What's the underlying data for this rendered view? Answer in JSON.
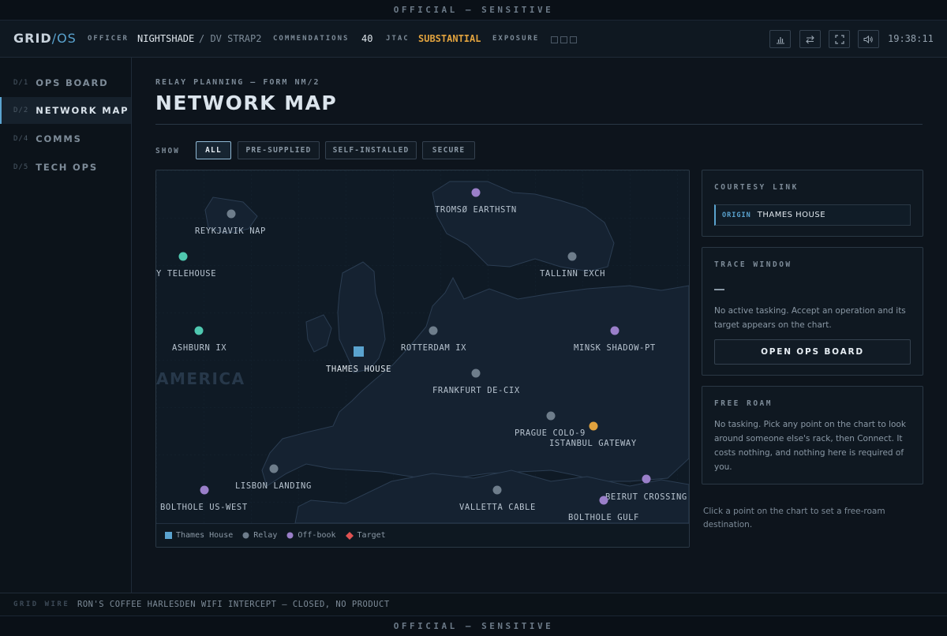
{
  "classification": "OFFICIAL — SENSITIVE",
  "topbar": {
    "brand": {
      "name": "GRID",
      "slash": "/",
      "os": "OS"
    },
    "officer_label": "OFFICER",
    "officer_name": "NIGHTSHADE",
    "officer_sub": "/ DV STRAP2",
    "commendations_label": "COMMENDATIONS",
    "commendations_value": "40",
    "jtac_label": "JTAC",
    "jtac_value": "SUBSTANTIAL",
    "exposure_label": "EXPOSURE",
    "exposure_level": 0,
    "exposure_max": 3,
    "buttons": [
      "bar-chart-icon",
      "swap-icon",
      "fullscreen-icon",
      "volume-icon"
    ],
    "clock": "19:38:11",
    "accent_color": "#5aa3cf",
    "amber_color": "#e0a23e"
  },
  "sidebar": {
    "items": [
      {
        "num": "D/1",
        "label": "OPS BOARD",
        "active": false
      },
      {
        "num": "D/2",
        "label": "NETWORK MAP",
        "active": true
      },
      {
        "num": "D/4",
        "label": "COMMS",
        "active": false
      },
      {
        "num": "D/5",
        "label": "TECH OPS",
        "active": false
      }
    ]
  },
  "gridwire": {
    "label": "GRID WIRE",
    "text": "RON'S COFFEE HARLESDEN WIFI INTERCEPT — CLOSED, NO PRODUCT"
  },
  "main": {
    "kicker": "RELAY PLANNING — FORM NM/2",
    "title": "NETWORK MAP",
    "show_label": "SHOW",
    "filters": [
      {
        "label": "ALL",
        "active": true
      },
      {
        "label": "PRE-SUPPLIED",
        "active": false
      },
      {
        "label": "SELF-INSTALLED",
        "active": false
      },
      {
        "label": "SECURE",
        "active": false
      }
    ]
  },
  "map": {
    "region_label": "AMERICA",
    "nodes": [
      {
        "label": "REYKJAVIK NAP",
        "type": "relay"
      },
      {
        "label": "TROMSØ EARTHSTN",
        "type": "offbook"
      },
      {
        "label": "Y TELEHOUSE",
        "type": "secure"
      },
      {
        "label": "TALLINN EXCH",
        "type": "relay"
      },
      {
        "label": "ASHBURN IX",
        "type": "secure"
      },
      {
        "label": "ROTTERDAM IX",
        "type": "relay"
      },
      {
        "label": "MINSK SHADOW-PT",
        "type": "offbook"
      },
      {
        "label": "THAMES HOUSE",
        "type": "home"
      },
      {
        "label": "FRANKFURT DE-CIX",
        "type": "relay"
      },
      {
        "label": "PRAGUE COLO-9",
        "type": "relay"
      },
      {
        "label": "ISTANBUL GATEWAY",
        "type": "gateway"
      },
      {
        "label": "LISBON LANDING",
        "type": "relay"
      },
      {
        "label": "BOLTHOLE US-WEST",
        "type": "offbook"
      },
      {
        "label": "VALLETTA CABLE",
        "type": "relay"
      },
      {
        "label": "BEIRUT CROSSING",
        "type": "offbook"
      },
      {
        "label": "BOLTHOLE GULF",
        "type": "offbook"
      }
    ],
    "colors": {
      "home": "#5aa3cf",
      "relay": "#6e7d8b",
      "offbook": "#9a7fc9",
      "secure": "#4fc8b0",
      "gateway": "#e0a23e",
      "target": "#e05252"
    },
    "legend": [
      {
        "label": "Thames House",
        "shape": "square",
        "color": "#5aa3cf"
      },
      {
        "label": "Relay",
        "shape": "circle",
        "color": "#6e7d8b"
      },
      {
        "label": "Off-book",
        "shape": "circle",
        "color": "#9a7fc9"
      },
      {
        "label": "Target",
        "shape": "diamond",
        "color": "#e05252"
      }
    ]
  },
  "panels": {
    "courtesy": {
      "title": "COURTESY LINK",
      "tag": "ORIGIN",
      "value": "THAMES HOUSE"
    },
    "trace": {
      "title": "TRACE WINDOW",
      "dash": "—",
      "body": "No active tasking. Accept an operation and its target appears on the chart.",
      "button": "OPEN OPS BOARD"
    },
    "freeroam": {
      "title": "FREE ROAM",
      "body": "No tasking. Pick any point on the chart to look around someone else's rack, then Connect. It costs nothing, and nothing here is required of you."
    },
    "hint": "Click a point on the chart to set a free-roam destination."
  }
}
